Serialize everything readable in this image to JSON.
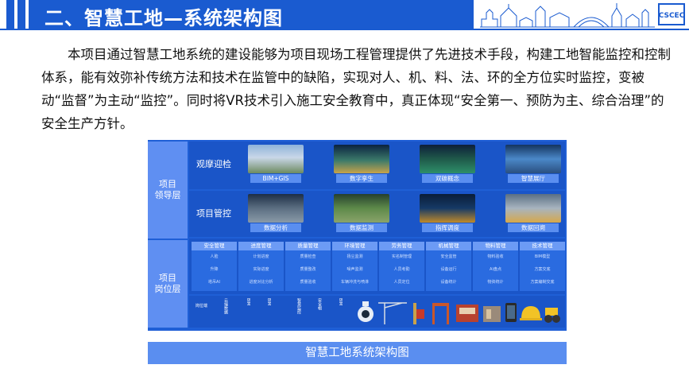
{
  "header": {
    "title": "二、智慧工地—系统架构图",
    "logo_text": "CSCEC",
    "brand_color": "#1a5bd0"
  },
  "intro": {
    "text": "本项目通过智慧工地系统的建设能够为项目现场工程管理提供了先进技术手段，构建工地智能监控和控制体系，能有效弥补传统方法和技术在监管中的缺陷，实现对人、机、料、法、环的全方位实时监控，变被动“监督”为主动“监控”。同时将VR技术引入施工安全教育中，真正体现“安全第一、预防为主、综合治理”的安全生产方针。"
  },
  "diagram": {
    "left_labels": [
      "项目\n领导层",
      "项目\n岗位层"
    ],
    "rows": [
      {
        "label": "观摩迎检",
        "tiles": [
          {
            "caption": "BIM+GIS"
          },
          {
            "caption": "数字孪生"
          },
          {
            "caption": "双碳概念"
          },
          {
            "caption": "智慧展厅"
          }
        ]
      },
      {
        "label": "项目管控",
        "tiles": [
          {
            "caption": "数据分析"
          },
          {
            "caption": "数据监测"
          },
          {
            "caption": "指挥调度"
          },
          {
            "caption": "数据回溯"
          }
        ]
      }
    ],
    "business_columns": [
      {
        "header": "安全管理",
        "items": [
          "人脸",
          "升降",
          "塔吊AI"
        ]
      },
      {
        "header": "进度管理",
        "items": [
          "计划进度",
          "实际进度",
          "进度对比分析"
        ]
      },
      {
        "header": "质量管理",
        "items": [
          "质量检查",
          "质量整改",
          "质量验收"
        ]
      },
      {
        "header": "环境管理",
        "items": [
          "扬尘监测",
          "噪声监测",
          "车辆冲洗与喷淋"
        ]
      },
      {
        "header": "劳务管理",
        "items": [
          "实名制管理",
          "人员考勤",
          "人员定位"
        ]
      },
      {
        "header": "机械管理",
        "items": [
          "安全监管",
          "设备运行",
          "设备统计"
        ]
      },
      {
        "header": "物料管理",
        "items": [
          "物料验收",
          "AI盘点",
          "物资统计"
        ]
      },
      {
        "header": "技术管理",
        "items": [
          "BIM模型",
          "方案交底",
          "方案编制交底"
        ]
      }
    ],
    "device_labels": [
      "岗位端",
      "云端数据",
      "BIM",
      "BIM",
      "智慧监控",
      "安全帽",
      "BIM"
    ],
    "caption": "智慧工地系统架构图"
  }
}
